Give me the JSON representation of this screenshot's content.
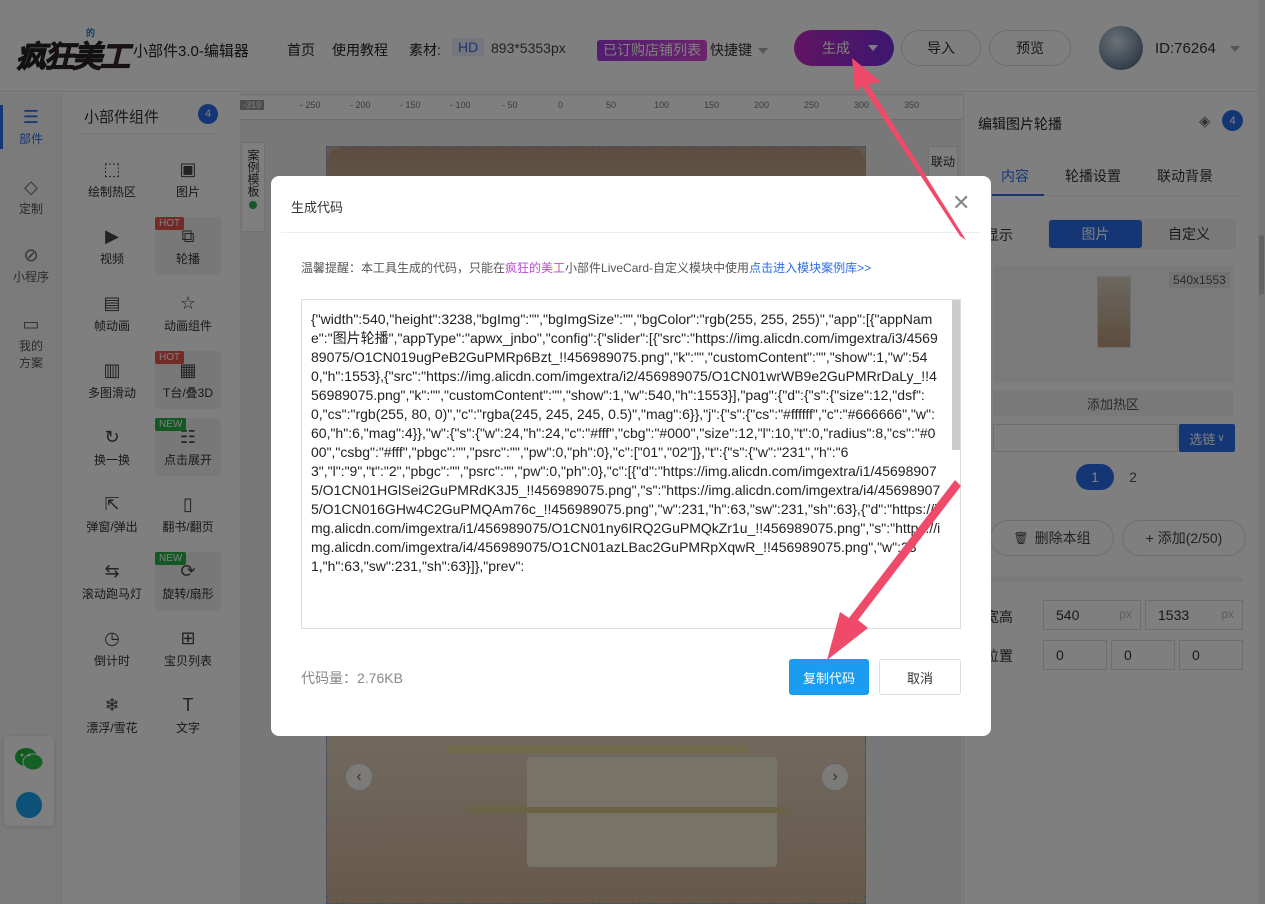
{
  "header": {
    "logo_text": "疯狂美工",
    "logo_sub": "的",
    "app_title": "小部件3.0-编辑器",
    "nav": [
      "首页",
      "使用教程",
      "素材:"
    ],
    "hd_label": "HD",
    "canvas_size": "893*5353px",
    "subscribed_label": "已订购店铺列表",
    "shortcut_label": "快捷键",
    "generate_label": "生成",
    "import_label": "导入",
    "preview_label": "预览",
    "user_id": "ID:76264"
  },
  "sidebar": {
    "items": [
      {
        "label": "部件",
        "icon": "components-icon"
      },
      {
        "label": "定制",
        "icon": "diamond-icon"
      },
      {
        "label": "小程序",
        "icon": "miniapp-icon"
      },
      {
        "label": "我的方案",
        "icon": "folder-icon"
      }
    ]
  },
  "components": {
    "title": "小部件组件",
    "count": "4",
    "tiles": [
      {
        "label": "绘制热区",
        "icon": "hotspot-icon",
        "tag": ""
      },
      {
        "label": "图片",
        "icon": "image-icon",
        "tag": ""
      },
      {
        "label": "视频",
        "icon": "video-icon",
        "tag": ""
      },
      {
        "label": "轮播",
        "icon": "carousel-icon",
        "tag": "HOT"
      },
      {
        "label": "帧动画",
        "icon": "frame-icon",
        "tag": ""
      },
      {
        "label": "动画组件",
        "icon": "star-icon",
        "tag": ""
      },
      {
        "label": "多图滑动",
        "icon": "slides-icon",
        "tag": ""
      },
      {
        "label": "T台/叠3D",
        "icon": "stage-icon",
        "tag": "HOT"
      },
      {
        "label": "换一换",
        "icon": "refresh-icon",
        "tag": ""
      },
      {
        "label": "点击展开",
        "icon": "expand-icon",
        "tag": "NEW"
      },
      {
        "label": "弹窗/弹出",
        "icon": "popup-icon",
        "tag": ""
      },
      {
        "label": "翻书/翻页",
        "icon": "book-icon",
        "tag": ""
      },
      {
        "label": "滚动跑马灯",
        "icon": "marquee-icon",
        "tag": ""
      },
      {
        "label": "旋转/扇形",
        "icon": "rotate-icon",
        "tag": "NEW"
      },
      {
        "label": "倒计时",
        "icon": "clock-icon",
        "tag": ""
      },
      {
        "label": "宝贝列表",
        "icon": "grid-icon",
        "tag": ""
      },
      {
        "label": "漂浮/雪花",
        "icon": "snowflake-icon",
        "tag": ""
      },
      {
        "label": "文字",
        "icon": "text-icon",
        "tag": ""
      }
    ]
  },
  "canvas": {
    "ruler_start": "-319",
    "ruler_labels": [
      "- 250",
      "- 200",
      "- 150",
      "- 100",
      "- 50",
      "0",
      "50",
      "100",
      "150",
      "200",
      "250",
      "300",
      "350",
      "400"
    ],
    "case_tab": "案例模板",
    "link_tab": "联动"
  },
  "props": {
    "title": "编辑图片轮播",
    "layers_count": "4",
    "tabs": [
      "内容",
      "轮播设置",
      "联动背景"
    ],
    "display_label": "显示",
    "seg_on": "图片",
    "seg_off": "自定义",
    "thumb_size": "540x1553",
    "add_hotspot": "添加热区",
    "select_label": "选链",
    "pages": [
      "1",
      "2"
    ],
    "delete_group": "删除本组",
    "add_label": "+ 添加(2/50)",
    "wh_label": "宽高",
    "pos_label": "位置",
    "width_val": "540",
    "height_val": "1533",
    "unit": "px",
    "pos_vals": [
      "0",
      "0",
      "0"
    ]
  },
  "dialog": {
    "title": "生成代码",
    "tip_prefix": "温馨提醒：本工具生成的代码，只能在",
    "tip_brand": "疯狂的美工",
    "tip_mid": "小部件LiveCard-自定义模块中使用",
    "tip_link": "点击进入模块案例库>>",
    "code": "{\"width\":540,\"height\":3238,\"bgImg\":\"\",\"bgImgSize\":\"\",\"bgColor\":\"rgb(255, 255, 255)\",\"app\":[{\"appName\":\"图片轮播\",\"appType\":\"apwx_jnbo\",\"config\":{\"slider\":[{\"src\":\"https://img.alicdn.com/imgextra/i3/456989075/O1CN019ugPeB2GuPMRp6Bzt_!!456989075.png\",\"k\":\"\",\"customContent\":\"\",\"show\":1,\"w\":540,\"h\":1553},{\"src\":\"https://img.alicdn.com/imgextra/i2/456989075/O1CN01wrWB9e2GuPMRrDaLy_!!456989075.png\",\"k\":\"\",\"customContent\":\"\",\"show\":1,\"w\":540,\"h\":1553}],\"pag\":{\"d\":{\"s\":{\"size\":12,\"dsf\":0,\"cs\":\"rgb(255, 80, 0)\",\"c\":\"rgba(245, 245, 245, 0.5)\",\"mag\":6}},\"j\":{\"s\":{\"cs\":\"#ffffff\",\"c\":\"#666666\",\"w\":60,\"h\":6,\"mag\":4}},\"w\":{\"s\":{\"w\":24,\"h\":24,\"c\":\"#fff\",\"cbg\":\"#000\",\"size\":12,\"l\":10,\"t\":0,\"radius\":8,\"cs\":\"#000\",\"csbg\":\"#fff\",\"pbgc\":\"\",\"psrc\":\"\",\"pw\":0,\"ph\":0},\"c\":[\"01\",\"02\"]},\"t\":{\"s\":{\"w\":\"231\",\"h\":\"63\",\"l\":\"9\",\"t\":\"2\",\"pbgc\":\"\",\"psrc\":\"\",\"pw\":0,\"ph\":0},\"c\":[{\"d\":\"https://img.alicdn.com/imgextra/i1/456989075/O1CN01HGlSei2GuPMRdK3J5_!!456989075.png\",\"s\":\"https://img.alicdn.com/imgextra/i4/456989075/O1CN016GHw4C2GuPMQAm76c_!!456989075.png\",\"w\":231,\"h\":63,\"sw\":231,\"sh\":63},{\"d\":\"https://img.alicdn.com/imgextra/i1/456989075/O1CN01ny6IRQ2GuPMQkZr1u_!!456989075.png\",\"s\":\"https://img.alicdn.com/imgextra/i4/456989075/O1CN01azLBac2GuPMRpXqwR_!!456989075.png\",\"w\":231,\"h\":63,\"sw\":231,\"sh\":63}]},\"prev\":",
    "code_size": "代码量：2.76KB",
    "copy_label": "复制代码",
    "cancel_label": "取消"
  },
  "colors": {
    "accent": "#2b6de8",
    "generate_gradient_start": "#c429c4",
    "generate_gradient_end": "#7a2ee0",
    "copy_button": "#1a9cf0",
    "arrow": "#f04a6a"
  }
}
